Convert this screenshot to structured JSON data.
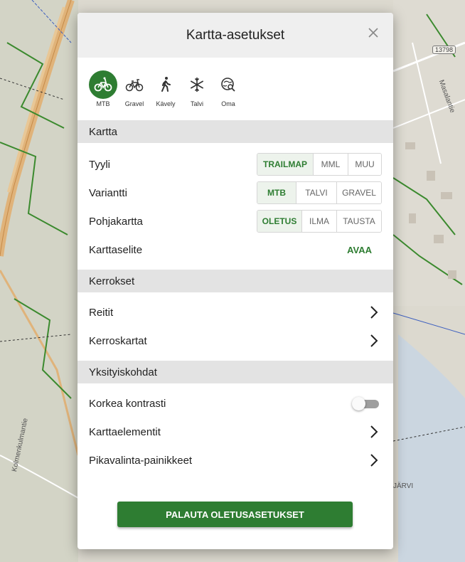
{
  "map": {
    "road_badge": "13798",
    "street_label": "Masalantie",
    "street_label_2": "Kolmenkulmantie",
    "lake_label": "JÄRVI"
  },
  "dialog": {
    "title": "Kartta-asetukset",
    "close_icon": "close-icon"
  },
  "profiles": [
    {
      "label": "MTB",
      "icon": "mtb-bike-icon",
      "active": true
    },
    {
      "label": "Gravel",
      "icon": "gravel-bike-icon",
      "active": false
    },
    {
      "label": "Kävely",
      "icon": "walking-icon",
      "active": false
    },
    {
      "label": "Talvi",
      "icon": "snowflake-icon",
      "active": false
    },
    {
      "label": "Oma",
      "icon": "custom-search-icon",
      "active": false
    }
  ],
  "kartta": {
    "header": "Kartta",
    "tyyli": {
      "label": "Tyyli",
      "options": [
        "TRAILMAP",
        "MML",
        "MUU"
      ],
      "selected": "TRAILMAP"
    },
    "variantti": {
      "label": "Variantti",
      "options": [
        "MTB",
        "TALVI",
        "GRAVEL"
      ],
      "selected": "MTB"
    },
    "pohjakartta": {
      "label": "Pohjakartta",
      "options": [
        "OLETUS",
        "ILMA",
        "TAUSTA"
      ],
      "selected": "OLETUS"
    },
    "karttaselite": {
      "label": "Karttaselite",
      "action": "AVAA"
    }
  },
  "kerrokset": {
    "header": "Kerrokset",
    "items": [
      {
        "label": "Reitit"
      },
      {
        "label": "Kerroskartat"
      }
    ]
  },
  "yksityiskohdat": {
    "header": "Yksityiskohdat",
    "korkea_kontrasti": {
      "label": "Korkea kontrasti",
      "enabled": false
    },
    "items": [
      {
        "label": "Karttaelementit"
      },
      {
        "label": "Pikavalinta-painikkeet"
      }
    ]
  },
  "reset_button": "PALAUTA OLETUSASETUKSET",
  "colors": {
    "accent": "#2e7d32",
    "section_bg": "#e3e3e3",
    "header_bg": "#efefef"
  }
}
